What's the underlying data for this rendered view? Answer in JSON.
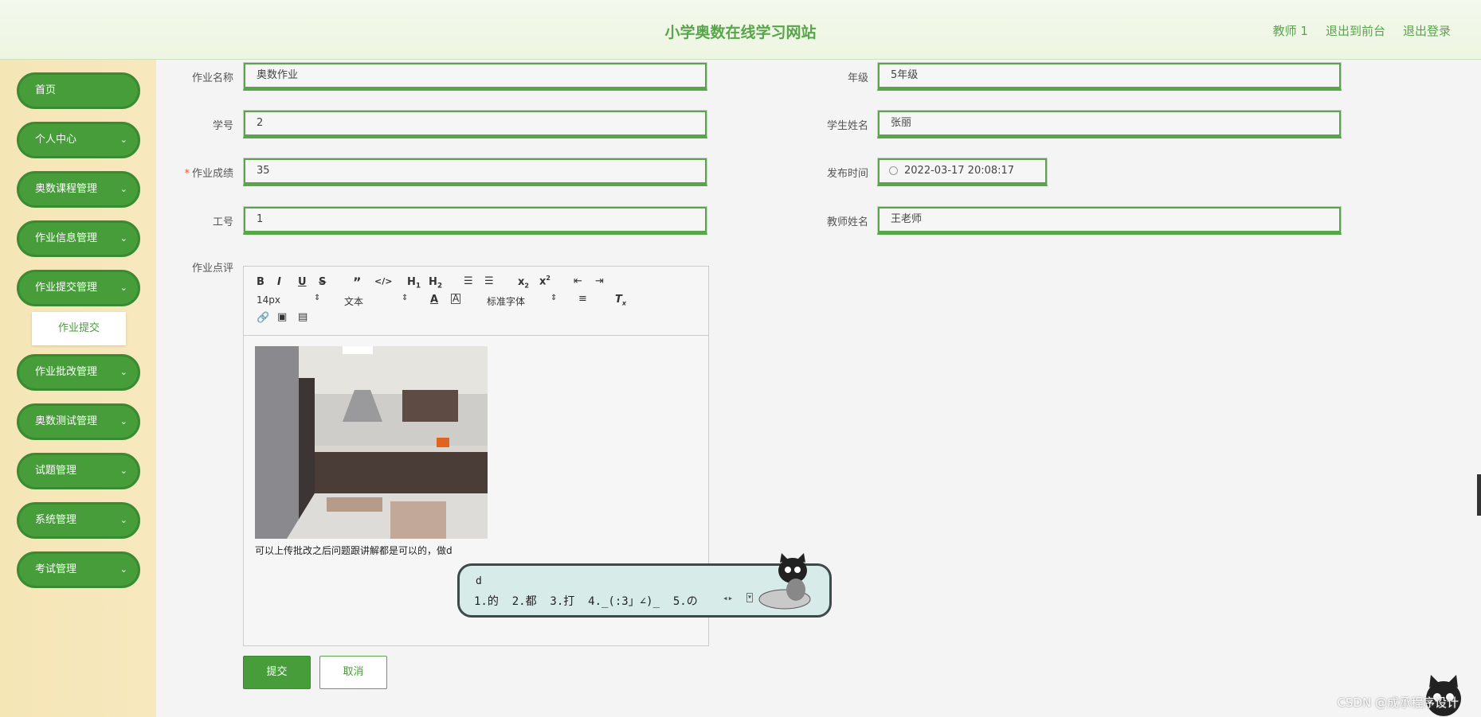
{
  "header": {
    "title": "小学奥数在线学习网站",
    "links": [
      "教师 1",
      "退出到前台",
      "退出登录"
    ]
  },
  "sidebar": {
    "items": [
      {
        "label": "首页",
        "chevron": false
      },
      {
        "label": "个人中心",
        "chevron": true
      },
      {
        "label": "奥数课程管理",
        "chevron": true
      },
      {
        "label": "作业信息管理",
        "chevron": true
      },
      {
        "label": "作业提交管理",
        "chevron": true
      },
      {
        "label": "作业批改管理",
        "chevron": true
      },
      {
        "label": "奥数测试管理",
        "chevron": true
      },
      {
        "label": "试题管理",
        "chevron": true
      },
      {
        "label": "系统管理",
        "chevron": true
      },
      {
        "label": "考试管理",
        "chevron": true
      }
    ],
    "submenu": "作业提交"
  },
  "form": {
    "homework_name": {
      "label": "作业名称",
      "value": "奥数作业"
    },
    "grade": {
      "label": "年级",
      "value": "5年级"
    },
    "student_id": {
      "label": "学号",
      "value": "2"
    },
    "student_name": {
      "label": "学生姓名",
      "value": "张丽"
    },
    "score": {
      "label": "作业成绩",
      "value": "35",
      "required": "*"
    },
    "publish_time": {
      "label": "发布时间",
      "value": "2022-03-17 20:08:17"
    },
    "teacher_id": {
      "label": "工号",
      "value": "1"
    },
    "teacher_name": {
      "label": "教师姓名",
      "value": "王老师"
    },
    "comment": {
      "label": "作业点评"
    }
  },
  "editor": {
    "font_size": "14px",
    "heading": "文本",
    "font_family": "标准字体",
    "text": "可以上传批改之后问题跟讲解都是可以的，做d"
  },
  "buttons": {
    "submit": "提交",
    "cancel": "取消"
  },
  "ime": {
    "input": "d",
    "candidates": "1.的  2.都  3.打  4._(:3」∠)_  5.の"
  },
  "watermark": "CSDN @成承程序设计"
}
